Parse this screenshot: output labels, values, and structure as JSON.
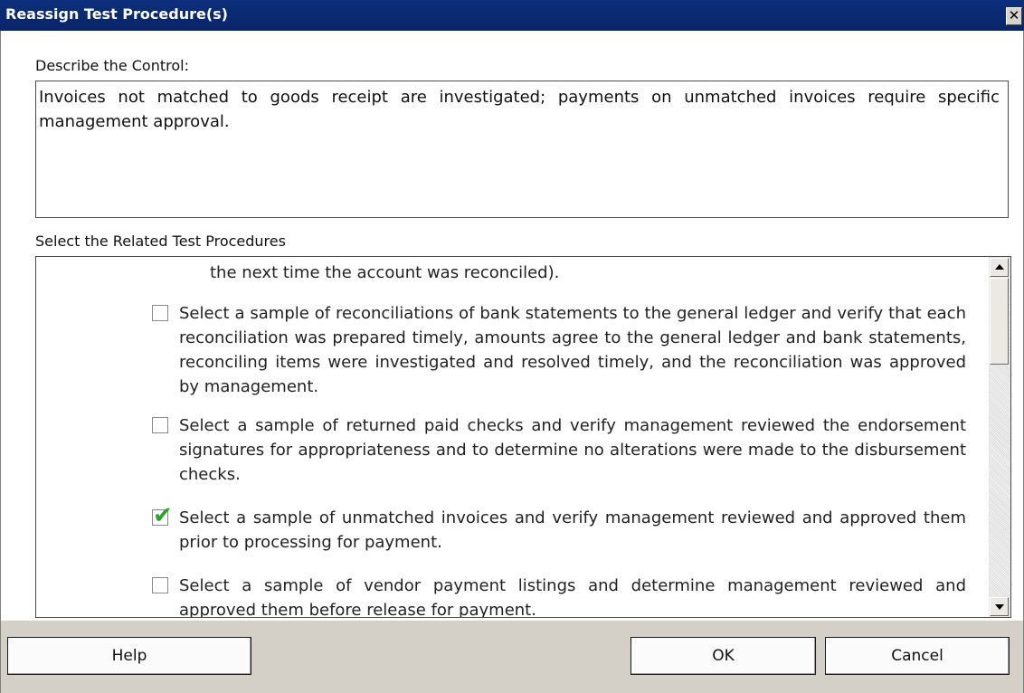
{
  "dialog": {
    "title": "Reassign Test Procedure(s)",
    "close_glyph": "✕"
  },
  "describe": {
    "label": "Describe the Control:",
    "text": "Invoices not matched to goods receipt are investigated; payments on unmatched invoices require specific management approval."
  },
  "procedures": {
    "label": "Select the Related Test Procedures",
    "top_fragment_line1": "— — — — — — — — — — — — — — — — — — — —",
    "top_fragment_line2": "the next time the account was reconciled).",
    "items": [
      {
        "checked": false,
        "text": "Select a sample of reconciliations of bank statements to the general ledger and verify that each reconciliation was prepared timely, amounts agree to the general ledger and bank statements, reconciling items were investigated and resolved timely, and the reconciliation was approved by management."
      },
      {
        "checked": false,
        "text": "Select a sample of returned paid checks and verify management reviewed the endorsement signatures for appropriateness and to determine no alterations were made to the disbursement checks."
      },
      {
        "checked": true,
        "text": "Select a sample of unmatched invoices and verify management reviewed and approved them prior to processing for payment."
      },
      {
        "checked": false,
        "text": "Select a sample of vendor payment listings and determine management reviewed and approved them before release for payment."
      }
    ],
    "check_mark": "✔"
  },
  "buttons": {
    "help": "Help",
    "ok": "OK",
    "cancel": "Cancel"
  },
  "colors": {
    "titlebar": "#0a246a",
    "check_green": "#2ea02e",
    "footer": "#d4d0c8"
  }
}
